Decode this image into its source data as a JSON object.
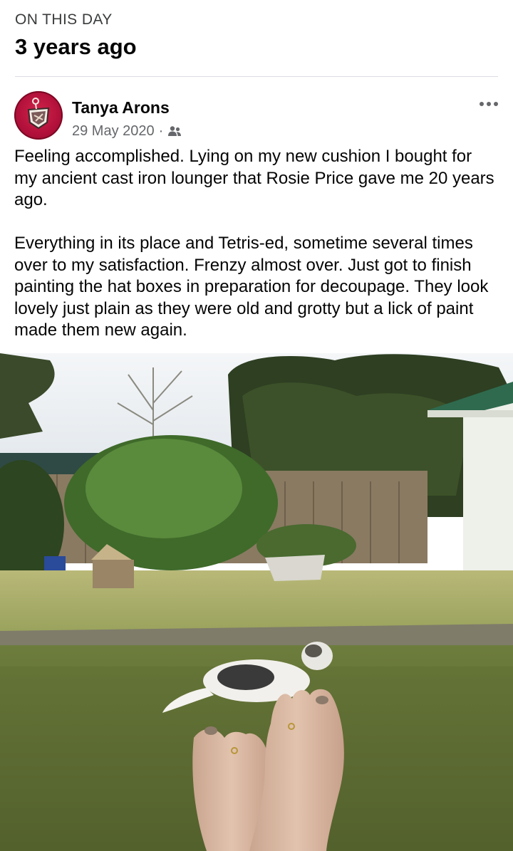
{
  "memory": {
    "eyebrow": "ON THIS DAY",
    "title": "3 years ago"
  },
  "post": {
    "author": "Tanya Arons",
    "date": "29 May 2020",
    "separator": "·",
    "audience_icon": "friends-icon",
    "more_icon": "more-options-icon",
    "paragraphs": [
      "Feeling accomplished.  Lying on my new cushion I bought for my ancient cast iron lounger that Rosie Price gave me 20 years ago.",
      "Everything in its place and Tetris-ed, sometime several times over to my satisfaction.  Frenzy almost over.  Just got to finish painting the hat boxes in preparation for decoupage.  They look lovely just plain as they were old and grotty but a lick of paint made them new again."
    ]
  },
  "colors": {
    "text_primary": "#050505",
    "text_secondary": "#65676b",
    "divider": "#dadde1",
    "avatar_bg": "#b0103a"
  }
}
